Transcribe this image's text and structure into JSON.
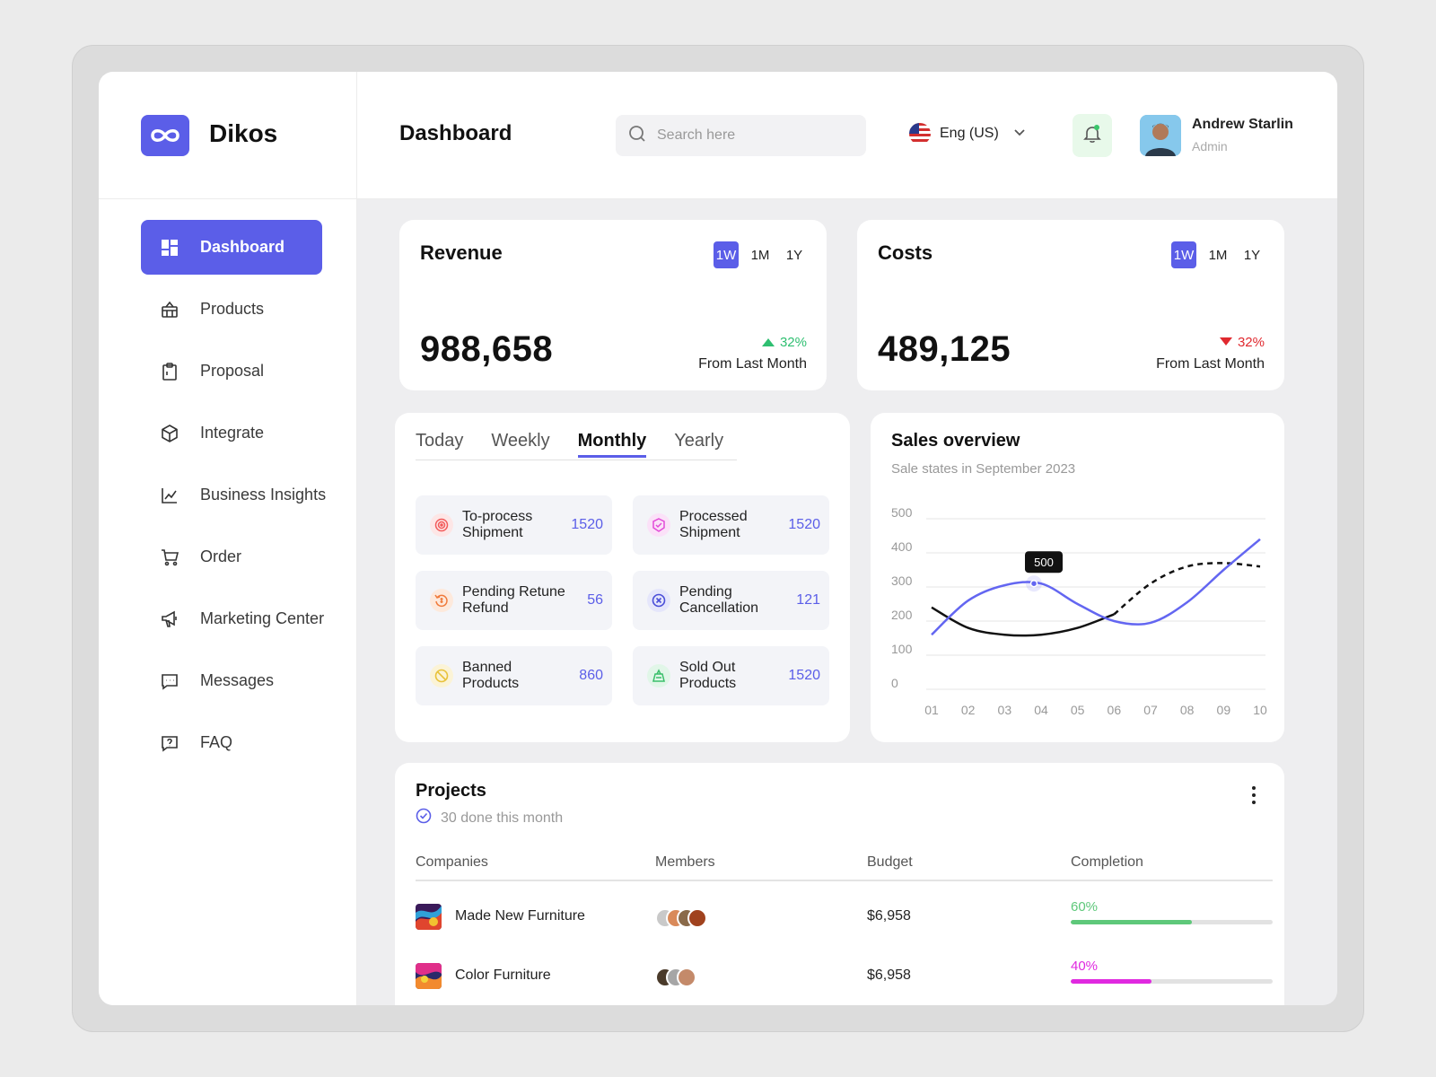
{
  "app": {
    "name": "Dikos"
  },
  "header": {
    "title": "Dashboard",
    "search_placeholder": "Search here",
    "language": "Eng (US)",
    "user": {
      "name": "Andrew Starlin",
      "role": "Admin"
    }
  },
  "sidebar": {
    "items": [
      {
        "label": "Dashboard",
        "icon": "dashboard-icon",
        "active": true
      },
      {
        "label": "Products",
        "icon": "basket-icon"
      },
      {
        "label": "Proposal",
        "icon": "clipboard-icon"
      },
      {
        "label": "Integrate",
        "icon": "cube-icon"
      },
      {
        "label": "Business Insights",
        "icon": "line-chart-icon"
      },
      {
        "label": "Order",
        "icon": "cart-icon"
      },
      {
        "label": "Marketing Center",
        "icon": "megaphone-icon"
      },
      {
        "label": "Messages",
        "icon": "message-icon"
      },
      {
        "label": "FAQ",
        "icon": "question-icon"
      }
    ]
  },
  "revenue": {
    "title": "Revenue",
    "ranges": [
      "1W",
      "1M",
      "1Y"
    ],
    "active_range": "1W",
    "value": "988,658",
    "change": "32%",
    "direction": "up",
    "from": "From Last Month",
    "color": "#2fbf71"
  },
  "costs": {
    "title": "Costs",
    "ranges": [
      "1W",
      "1M",
      "1Y"
    ],
    "active_range": "1W",
    "value": "489,125",
    "change": "32%",
    "direction": "down",
    "from": "From Last Month",
    "color": "#e0292f"
  },
  "orders": {
    "tabs": [
      "Today",
      "Weekly",
      "Monthly",
      "Yearly"
    ],
    "active_tab": "Monthly",
    "tiles": [
      {
        "label_1": "To-process",
        "label_2": "Shipment",
        "value": "1520",
        "icon": "target-icon",
        "icon_color": "#f25a5a",
        "icon_bg": "#fde6e6"
      },
      {
        "label_1": "Processed",
        "label_2": "Shipment",
        "value": "1520",
        "icon": "box-check-icon",
        "icon_color": "#e24ad8",
        "icon_bg": "#fbe1f8"
      },
      {
        "label_1": "Pending Retune",
        "label_2": "Refund",
        "value": "56",
        "icon": "refund-icon",
        "icon_color": "#f07a3a",
        "icon_bg": "#fde9dc"
      },
      {
        "label_1": "Pending",
        "label_2": "Cancellation",
        "value": "121",
        "icon": "cancel-icon",
        "icon_color": "#4a4ed8",
        "icon_bg": "#e5e6fb"
      },
      {
        "label_1": "Banned",
        "label_2": "Products",
        "value": "860",
        "icon": "banned-icon",
        "icon_color": "#e8c23a",
        "icon_bg": "#fbf3d6"
      },
      {
        "label_1": "Sold Out",
        "label_2": "Products",
        "value": "1520",
        "icon": "sold-out-icon",
        "icon_color": "#3abf6a",
        "icon_bg": "#e1f6e8"
      }
    ]
  },
  "chart_data": {
    "type": "line",
    "title": "Sales overview",
    "subtitle": "Sale states in September 2023",
    "x": [
      "01",
      "02",
      "03",
      "04",
      "05",
      "06",
      "07",
      "08",
      "09",
      "10"
    ],
    "ylim": [
      0,
      500
    ],
    "yticks": [
      "500",
      "400",
      "300",
      "200",
      "100",
      "0"
    ],
    "grid": true,
    "series": [
      {
        "color": "#6366f1",
        "style": "solid",
        "values": [
          160,
          260,
          305,
          310,
          250,
          200,
          195,
          255,
          350,
          440
        ]
      },
      {
        "color": "#111111",
        "style": "solid-then-dashed",
        "values": [
          240,
          180,
          160,
          160,
          180,
          220,
          310,
          360,
          370,
          360
        ]
      }
    ],
    "annotation": {
      "x": "04",
      "label": "500"
    }
  },
  "projects": {
    "title": "Projects",
    "subtitle": "30 done this month",
    "columns": [
      "Companies",
      "Members",
      "Budget",
      "Completion"
    ],
    "rows": [
      {
        "company": "Made New Furniture",
        "budget": "$6,958",
        "completion": "60%",
        "progress": 0.6,
        "color": "#5ec87a",
        "members": [
          "#c9c9c9",
          "#d98a5a",
          "#8a6a4a",
          "#a0421e"
        ]
      },
      {
        "company": "Color Furniture",
        "budget": "$6,958",
        "completion": "40%",
        "progress": 0.4,
        "color": "#e029e0",
        "members": [
          "#4a3a2a",
          "#a6a6a6",
          "#c48a6a"
        ]
      }
    ]
  }
}
